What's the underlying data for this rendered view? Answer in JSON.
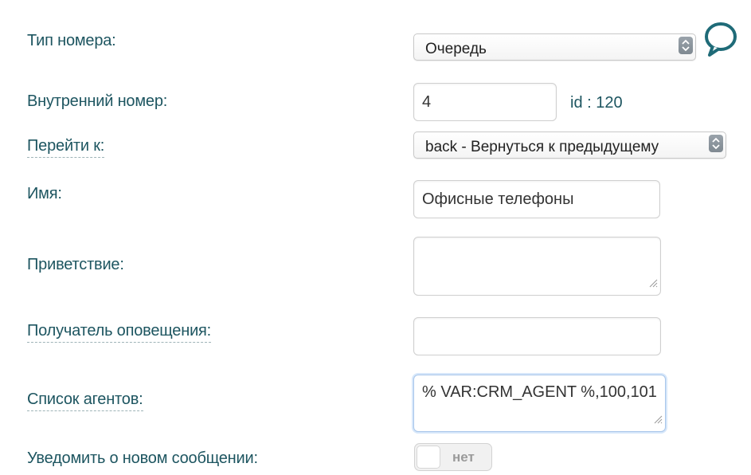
{
  "form": {
    "number_type": {
      "label": "Тип номера:",
      "value": "Очередь"
    },
    "internal_number": {
      "label": "Внутренний номер:",
      "value": "4",
      "id_text": "id : 120"
    },
    "go_to": {
      "label": "Перейти к:",
      "value": "back - Вернуться к предыдущему"
    },
    "name": {
      "label": "Имя:",
      "value": "Офисные телефоны"
    },
    "greeting": {
      "label": "Приветствие:",
      "value": ""
    },
    "notify_recipient": {
      "label": "Получатель оповещения:",
      "value": ""
    },
    "agents_list": {
      "label": "Список агентов:",
      "value": "% VAR:CRM_AGENT %,100,101"
    },
    "notify_new_message": {
      "label": "Уведомить о новом сообщении:",
      "toggle_text": "нет",
      "state": "off"
    }
  },
  "icons": {
    "chat": "speech-bubble-icon",
    "select_arrows": "updown-arrows-icon",
    "resize": "resize-grip-icon"
  },
  "colors": {
    "label": "#1d5560",
    "icon": "#1f6b78"
  }
}
